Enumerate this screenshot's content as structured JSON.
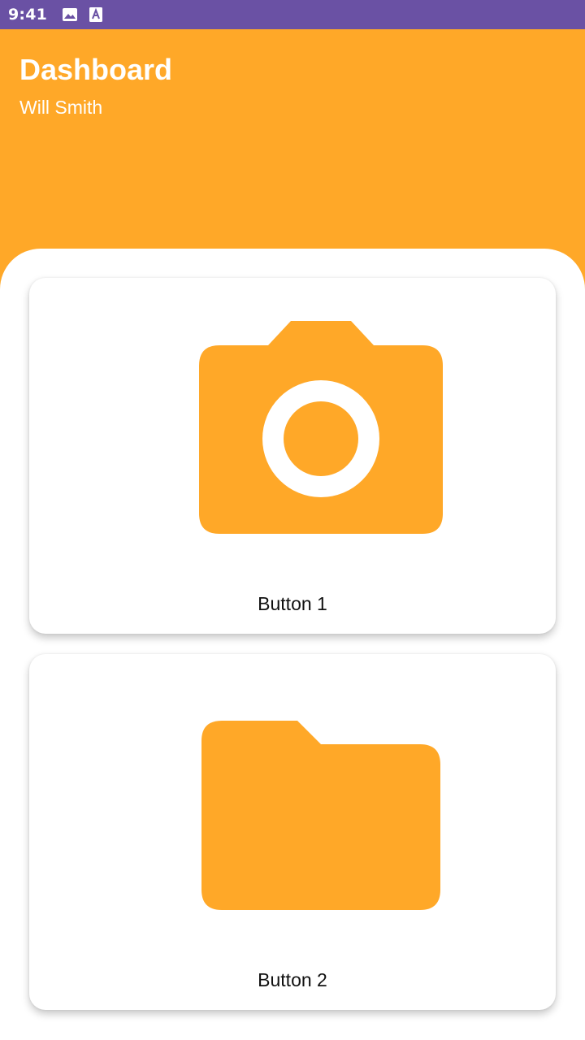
{
  "status_bar": {
    "time": "9:41",
    "icons": [
      "image-icon",
      "text-a-icon"
    ],
    "background": "#6a51a4"
  },
  "header": {
    "title": "Dashboard",
    "subtitle": "Will Smith",
    "background": "#ffa828"
  },
  "cards": [
    {
      "label": "Button 1",
      "icon": "camera-icon"
    },
    {
      "label": "Button 2",
      "icon": "folder-icon"
    }
  ],
  "colors": {
    "accent": "#ffa828",
    "card_background": "#ffffff",
    "label_text": "#111111"
  }
}
